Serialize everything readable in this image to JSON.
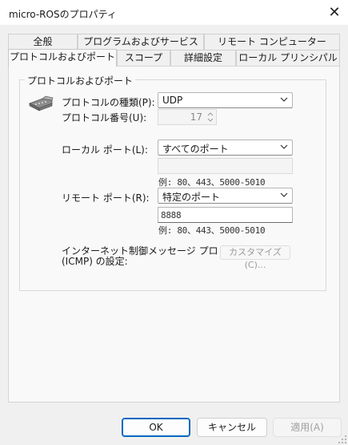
{
  "window": {
    "title": "micro-ROSのプロパティ",
    "close_glyph": "✕"
  },
  "tabs_row1": [
    {
      "label": "全般"
    },
    {
      "label": "プログラムおよびサービス"
    },
    {
      "label": "リモート コンピューター"
    }
  ],
  "tabs_row2": [
    {
      "label": "プロトコルおよびポート",
      "active": true
    },
    {
      "label": "スコープ"
    },
    {
      "label": "詳細設定"
    },
    {
      "label": "ローカル プリンシパル"
    }
  ],
  "group": {
    "title": "プロトコルおよびポート",
    "protocol_type_label": "プロトコルの種類(P):",
    "protocol_type_value": "UDP",
    "protocol_number_label": "プロトコル番号(U):",
    "protocol_number_value": "17",
    "local_port_label": "ローカル ポート(L):",
    "local_port_value": "すべてのポート",
    "local_port_input": "",
    "local_port_hint": "例: 80、443、5000-5010",
    "remote_port_label": "リモート ポート(R):",
    "remote_port_value": "特定のポート",
    "remote_port_input": "8888",
    "remote_port_hint": "例: 80、443、5000-5010",
    "icmp_label_line1": "インターネット制御メッセージ プロトコル",
    "icmp_label_line2": "(ICMP) の設定:",
    "customize_button": "カスタマイズ(C)..."
  },
  "footer": {
    "ok": "OK",
    "cancel": "キャンセル",
    "apply": "適用(A)"
  },
  "colors": {
    "accent": "#0067c0",
    "window_bg": "#f0f0f0",
    "panel_bg": "#f9f9f9"
  }
}
